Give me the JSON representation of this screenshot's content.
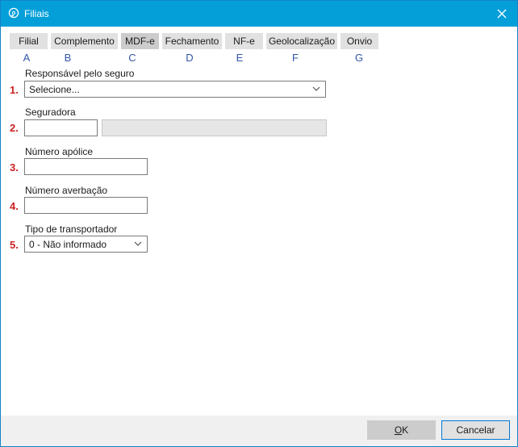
{
  "window": {
    "title": "Filiais"
  },
  "tabs": [
    {
      "label": "Filial",
      "letter": "A"
    },
    {
      "label": "Complemento",
      "letter": "B"
    },
    {
      "label": "MDF-e",
      "letter": "C"
    },
    {
      "label": "Fechamento",
      "letter": "D"
    },
    {
      "label": "NF-e",
      "letter": "E"
    },
    {
      "label": "Geolocalização",
      "letter": "F"
    },
    {
      "label": "Onvio",
      "letter": "G"
    }
  ],
  "active_tab": "MDF-e",
  "fields": [
    {
      "number": "1.",
      "label": "Responsável pelo seguro",
      "value": "Selecione..."
    },
    {
      "number": "2.",
      "label": "Seguradora",
      "code": "",
      "name": ""
    },
    {
      "number": "3.",
      "label": "Número apólice",
      "value": ""
    },
    {
      "number": "4.",
      "label": "Número averbação",
      "value": ""
    },
    {
      "number": "5.",
      "label": "Tipo de transportador",
      "value": "0 - Não informado"
    }
  ],
  "buttons": {
    "ok_prefix": "",
    "ok_accel": "O",
    "ok_rest": "K",
    "cancel": "Cancelar"
  },
  "icons": {
    "app": "chat-bubble-icon",
    "close": "close-icon",
    "dropdown": "chevron-down-icon"
  },
  "colors": {
    "titlebar": "#049fd9",
    "annotation_number": "#cc2222",
    "annotation_letter": "#3355aa",
    "focus_border": "#0078d7"
  }
}
